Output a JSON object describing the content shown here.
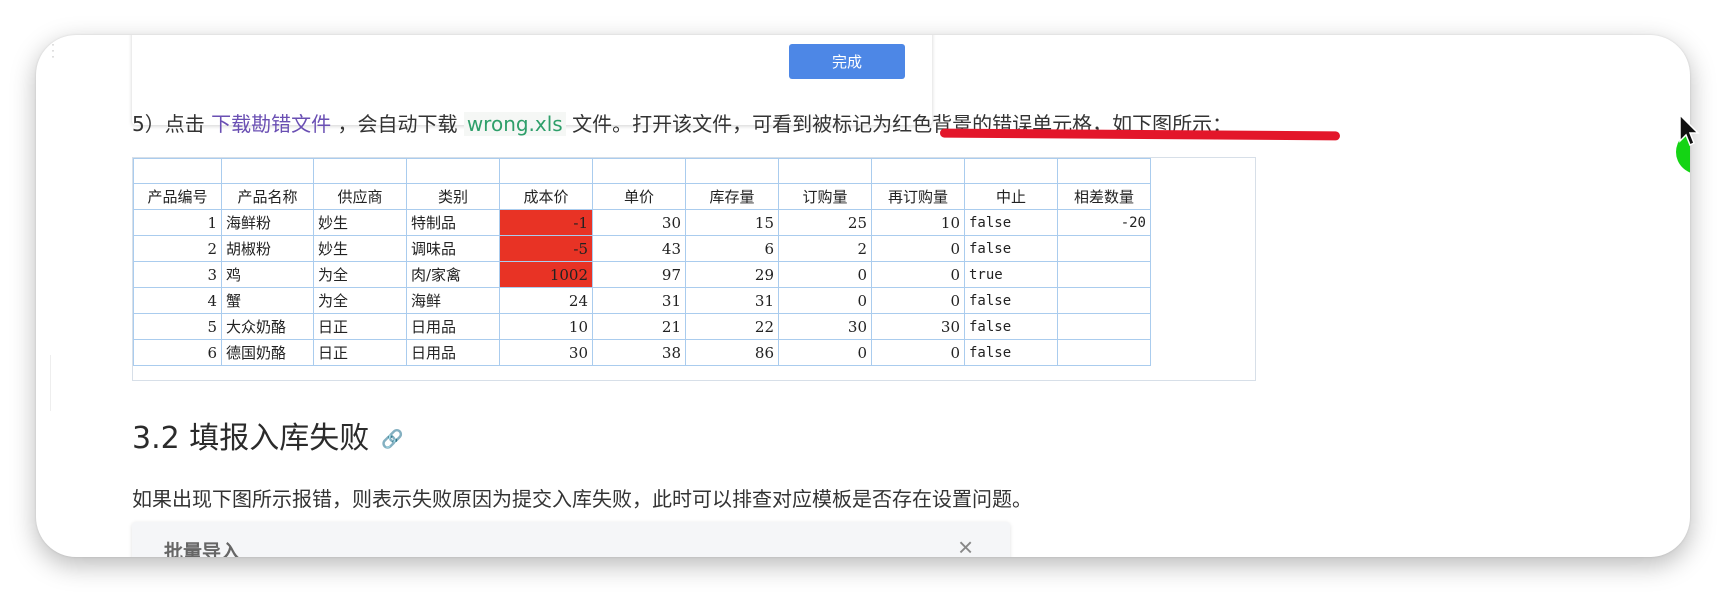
{
  "dialog_top": {
    "done_label": "完成"
  },
  "step5": {
    "prefix": "5）点击",
    "link": "下载勘错文件",
    "mid": "，会自动下载",
    "filename": "wrong.xls",
    "suffix": "文件。打开该文件，可看到被标记为红色背景的错误单元格，如下图所示："
  },
  "spreadsheet": {
    "headers": [
      "产品编号",
      "产品名称",
      "供应商",
      "类别",
      "成本价",
      "单价",
      "库存量",
      "订购量",
      "再订购量",
      "中止",
      "相差数量"
    ],
    "rows": [
      [
        "1",
        "海鲜粉",
        "妙生",
        "特制品",
        "-1",
        "30",
        "15",
        "25",
        "10",
        "false",
        "-20"
      ],
      [
        "2",
        "胡椒粉",
        "妙生",
        "调味品",
        "-5",
        "43",
        "6",
        "2",
        "0",
        "false",
        ""
      ],
      [
        "3",
        "鸡",
        "为全",
        "肉/家禽",
        "1002",
        "97",
        "29",
        "0",
        "0",
        "true",
        ""
      ],
      [
        "4",
        "蟹",
        "为全",
        "海鲜",
        "24",
        "31",
        "31",
        "0",
        "0",
        "false",
        ""
      ],
      [
        "5",
        "大众奶酪",
        "日正",
        "日用品",
        "10",
        "21",
        "22",
        "30",
        "30",
        "false",
        ""
      ],
      [
        "6",
        "德国奶酪",
        "日正",
        "日用品",
        "30",
        "38",
        "86",
        "0",
        "0",
        "false",
        ""
      ]
    ],
    "error_color": "#e83325"
  },
  "section": {
    "title": "3.2 填报入库失败"
  },
  "failure_text": "如果出现下图所示报错，则表示失败原因为提交入库失败，此时可以排查对应模板是否存在设置问题。",
  "dialog_bottom": {
    "title": "批量导入",
    "close_symbol": "×"
  }
}
